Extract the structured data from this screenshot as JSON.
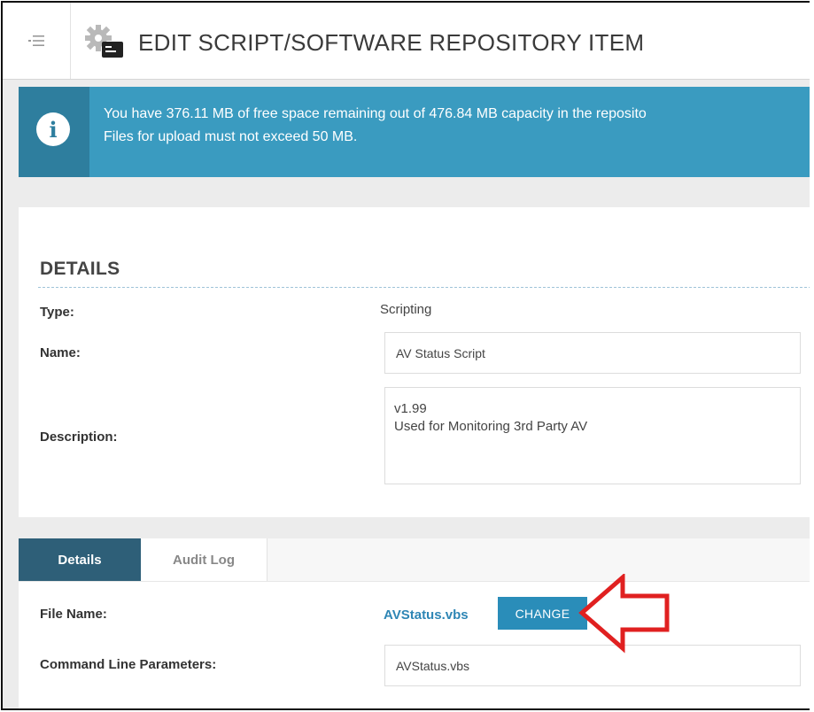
{
  "header": {
    "title": "EDIT SCRIPT/SOFTWARE REPOSITORY ITEM",
    "menu_icon": "collapse-menu-icon",
    "page_icon": "gear-script-icon"
  },
  "info": {
    "line1": "You have 376.11 MB of free space remaining out of 476.84 MB capacity in the reposito",
    "line2": "Files for upload must not exceed 50 MB.",
    "icon": "info-icon"
  },
  "details": {
    "section_title": "DETAILS",
    "type_label": "Type:",
    "type_value": "Scripting",
    "name_label": "Name:",
    "name_value": "AV Status Script",
    "description_label": "Description:",
    "description_line1": "v1.99",
    "description_line2": "Used for Monitoring 3rd Party AV"
  },
  "tabs": {
    "details": "Details",
    "audit_log": "Audit Log"
  },
  "file": {
    "file_name_label": "File Name:",
    "file_name_value": "AVStatus.vbs",
    "change_label": "CHANGE",
    "cmd_label": "Command Line Parameters:",
    "cmd_value": "AVStatus.vbs"
  },
  "colors": {
    "banner": "#3a9bc0",
    "banner_icon_bg": "#2e7e9e",
    "tab_active": "#2e5f78",
    "button": "#2a8db9",
    "link": "#2e86b5",
    "annotation_arrow": "#e02020"
  }
}
